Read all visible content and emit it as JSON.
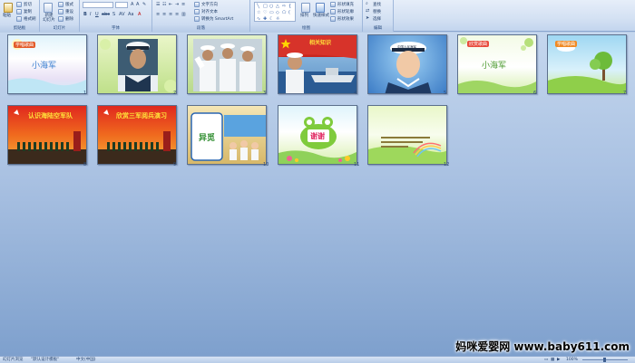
{
  "ribbon": {
    "groups": [
      {
        "name": "clipboard",
        "label": "剪贴板"
      },
      {
        "name": "slides",
        "label": "幻灯片"
      },
      {
        "name": "font",
        "label": "字体"
      },
      {
        "name": "paragraph",
        "label": "段落"
      },
      {
        "name": "drawing",
        "label": "绘图"
      },
      {
        "name": "editing",
        "label": "编辑"
      }
    ],
    "paste_label": "粘贴",
    "cut_label": "剪切",
    "copy_label": "复制",
    "format_label": "格式刷",
    "new_slide_label": "新建\n幻灯片",
    "layout_label": "版式",
    "reset_label": "重设",
    "delete_label": "删除",
    "text_direction_label": "文字方向",
    "align_text_label": "对齐文本",
    "smartart_label": "转换为 SmartArt",
    "arrange_label": "排列",
    "quick_styles_label": "快速样式",
    "shape_fill_label": "形状填充",
    "shape_outline_label": "形状轮廓",
    "shape_effects_label": "形状效果",
    "find_label": "查找",
    "replace_label": "替换",
    "select_label": "选择"
  },
  "slides": [
    {
      "number": "1",
      "title": "小海军",
      "badge": "学唱歌曲"
    },
    {
      "number": "2",
      "title": ""
    },
    {
      "number": "3",
      "title": ""
    },
    {
      "number": "4",
      "title": "",
      "badge": "相关知识"
    },
    {
      "number": "5",
      "title": "",
      "cap": "中国人民海军"
    },
    {
      "number": "6",
      "title": "小海军",
      "badge": "欣赏歌曲"
    },
    {
      "number": "7",
      "title": "",
      "badge": "学唱歌曲"
    },
    {
      "number": "8",
      "title": "认识海陆空军队"
    },
    {
      "number": "9",
      "title": "欣赏三军阅兵演习"
    },
    {
      "number": "10",
      "title": "异觅"
    },
    {
      "number": "11",
      "title": "谢谢"
    },
    {
      "number": "12",
      "title": ""
    }
  ],
  "status": {
    "view": "幻灯片浏览",
    "theme": "\"默认设计模板\"",
    "language": "中文(中国)",
    "zoom": "100%"
  },
  "watermark": "妈咪爱婴网 www.baby611.com"
}
